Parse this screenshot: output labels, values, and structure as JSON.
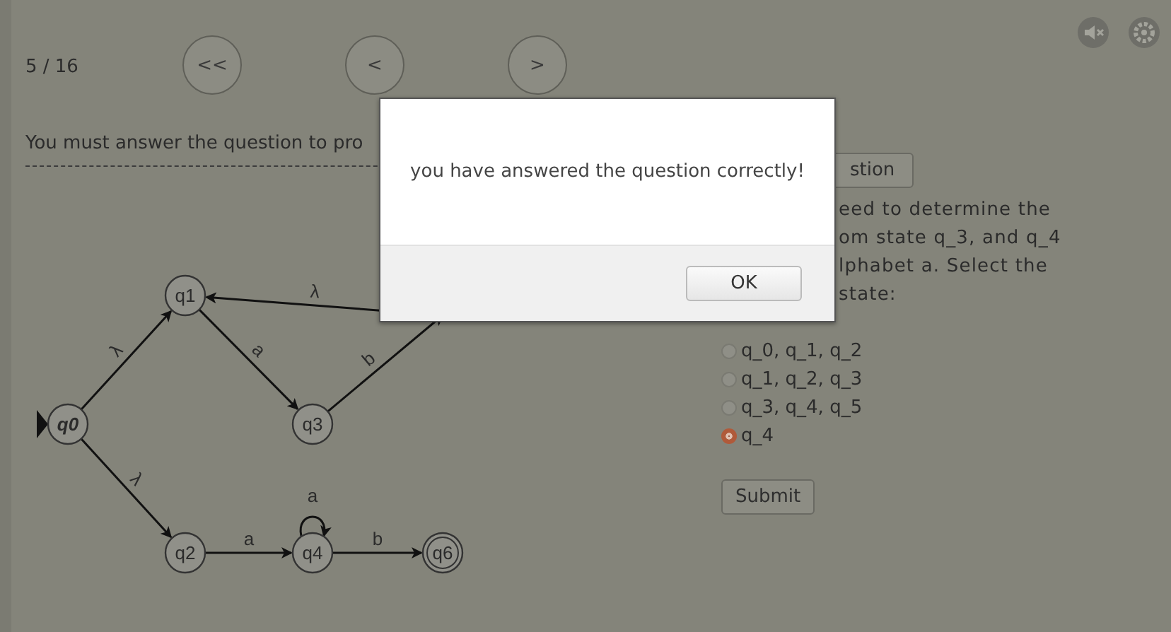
{
  "header": {
    "progress": "5 / 16",
    "nav_buttons": [
      "<<",
      "<",
      ">"
    ]
  },
  "notice": "You must answer the question to pro",
  "question_button": "stion",
  "question_text": "eed to determine the\nom state q_3, and q_4\nlphabet a. Select the\nstate:",
  "options": [
    {
      "label": "q_0, q_1, q_2",
      "selected": false
    },
    {
      "label": "q_1, q_2, q_3",
      "selected": false
    },
    {
      "label": "q_3, q_4, q_5",
      "selected": false
    },
    {
      "label": "q_4",
      "selected": true
    }
  ],
  "submit_button": "Submit",
  "automaton": {
    "states": [
      {
        "label": "q0",
        "initial": true,
        "final": false
      },
      {
        "label": "q1",
        "initial": false,
        "final": false
      },
      {
        "label": "q2",
        "initial": false,
        "final": false
      },
      {
        "label": "q3",
        "initial": false,
        "final": false
      },
      {
        "label": "q4",
        "initial": false,
        "final": false
      },
      {
        "label": "q6",
        "initial": false,
        "final": true
      }
    ],
    "transitions": [
      {
        "label": "λ"
      },
      {
        "label": "λ"
      },
      {
        "label": "a"
      },
      {
        "label": "b"
      },
      {
        "label": "λ"
      },
      {
        "label": "a"
      },
      {
        "label": "a"
      },
      {
        "label": "b"
      }
    ]
  },
  "dialog": {
    "message": "you have answered the question correctly!",
    "button": "OK"
  }
}
